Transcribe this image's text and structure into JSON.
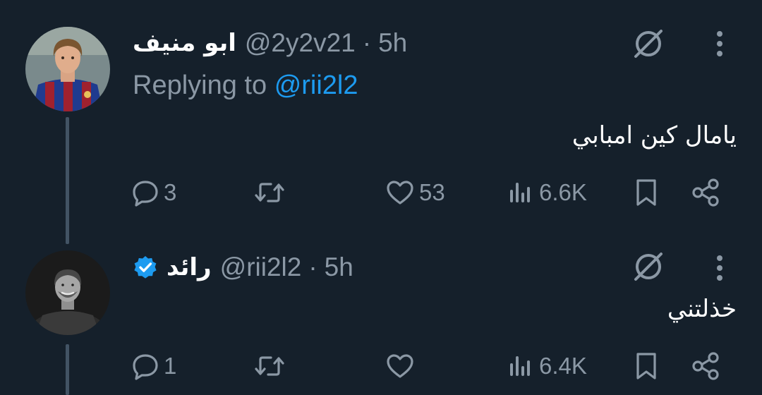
{
  "colors": {
    "background": "#15202b",
    "text_primary": "#ffffff",
    "text_secondary": "#8b98a5",
    "accent": "#1d9bf0",
    "thread_line": "#425364"
  },
  "tweets": [
    {
      "display_name": "ابو منيف",
      "handle": "@2y2v21",
      "separator": "·",
      "time": "5h",
      "verified": false,
      "replying_prefix": "Replying to",
      "replying_to": "@rii2l2",
      "text": "يامال كين امبابي",
      "counts": {
        "replies": "3",
        "retweets": "",
        "likes": "53",
        "views": "6.6K"
      },
      "icons": {
        "grok": "grok-icon",
        "more": "more-vertical-icon"
      }
    },
    {
      "display_name": "رائد",
      "handle": "@rii2l2",
      "separator": "·",
      "time": "5h",
      "verified": true,
      "text": "خذلتني",
      "counts": {
        "replies": "1",
        "retweets": "",
        "likes": "",
        "views": "6.4K"
      },
      "icons": {
        "grok": "grok-icon",
        "more": "more-vertical-icon"
      }
    }
  ]
}
